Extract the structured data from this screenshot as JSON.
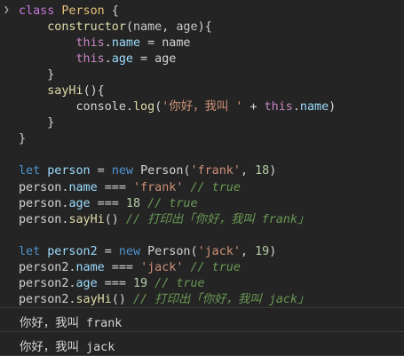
{
  "console": {
    "prompt_icon": "chevron-right-icon",
    "code_lines": [
      [
        [
          "kw",
          "class "
        ],
        [
          "cls",
          "Person"
        ],
        [
          "pl",
          " {"
        ]
      ],
      [
        [
          "pl",
          "    "
        ],
        [
          "fn",
          "constructor"
        ],
        [
          "pl",
          "("
        ],
        [
          "param",
          "name"
        ],
        [
          "pl",
          ", "
        ],
        [
          "param",
          "age"
        ],
        [
          "pl",
          "){"
        ]
      ],
      [
        [
          "pl",
          "        "
        ],
        [
          "this",
          "this"
        ],
        [
          "pl",
          "."
        ],
        [
          "prop",
          "name"
        ],
        [
          "pl",
          " = name"
        ]
      ],
      [
        [
          "pl",
          "        "
        ],
        [
          "this",
          "this"
        ],
        [
          "pl",
          "."
        ],
        [
          "prop",
          "age"
        ],
        [
          "pl",
          " = age"
        ]
      ],
      [
        [
          "pl",
          "    }"
        ]
      ],
      [
        [
          "pl",
          "    "
        ],
        [
          "fn",
          "sayHi"
        ],
        [
          "pl",
          "(){"
        ]
      ],
      [
        [
          "pl",
          "        console."
        ],
        [
          "fn",
          "log"
        ],
        [
          "pl",
          "("
        ],
        [
          "str",
          "'你好，我叫 '"
        ],
        [
          "pl",
          " + "
        ],
        [
          "this",
          "this"
        ],
        [
          "pl",
          "."
        ],
        [
          "prop",
          "name"
        ],
        [
          "pl",
          ")"
        ]
      ],
      [
        [
          "pl",
          "    }"
        ]
      ],
      [
        [
          "pl",
          "}"
        ]
      ],
      [],
      [
        [
          "kw-blue",
          "let "
        ],
        [
          "var",
          "person"
        ],
        [
          "pl",
          " = "
        ],
        [
          "kw-blue",
          "new "
        ],
        [
          "pl",
          "Person("
        ],
        [
          "str",
          "'frank'"
        ],
        [
          "pl",
          ", "
        ],
        [
          "num",
          "18"
        ],
        [
          "pl",
          ")"
        ]
      ],
      [
        [
          "pl",
          "person."
        ],
        [
          "prop",
          "name"
        ],
        [
          "pl",
          " === "
        ],
        [
          "str",
          "'frank'"
        ],
        [
          "cm",
          " // true"
        ]
      ],
      [
        [
          "pl",
          "person."
        ],
        [
          "prop",
          "age"
        ],
        [
          "pl",
          " === "
        ],
        [
          "num",
          "18"
        ],
        [
          "cm",
          " // true"
        ]
      ],
      [
        [
          "pl",
          "person."
        ],
        [
          "fn",
          "sayHi"
        ],
        [
          "pl",
          "()"
        ],
        [
          "cm",
          " // 打印出「你好，我叫 frank」"
        ]
      ],
      [],
      [
        [
          "kw-blue",
          "let "
        ],
        [
          "var",
          "person2"
        ],
        [
          "pl",
          " = "
        ],
        [
          "kw-blue",
          "new "
        ],
        [
          "pl",
          "Person("
        ],
        [
          "str",
          "'jack'"
        ],
        [
          "pl",
          ", "
        ],
        [
          "num",
          "19"
        ],
        [
          "pl",
          ")"
        ]
      ],
      [
        [
          "pl",
          "person2."
        ],
        [
          "prop",
          "name"
        ],
        [
          "pl",
          " === "
        ],
        [
          "str",
          "'jack'"
        ],
        [
          "cm",
          " // true"
        ]
      ],
      [
        [
          "pl",
          "person2."
        ],
        [
          "prop",
          "age"
        ],
        [
          "pl",
          " === "
        ],
        [
          "num",
          "19"
        ],
        [
          "cm",
          " // true"
        ]
      ],
      [
        [
          "pl",
          "person2."
        ],
        [
          "fn",
          "sayHi"
        ],
        [
          "pl",
          "()"
        ],
        [
          "cm",
          " // 打印出「你好，我叫 jack」"
        ]
      ]
    ],
    "outputs": [
      "你好，我叫 frank",
      "你好，我叫 jack"
    ]
  }
}
